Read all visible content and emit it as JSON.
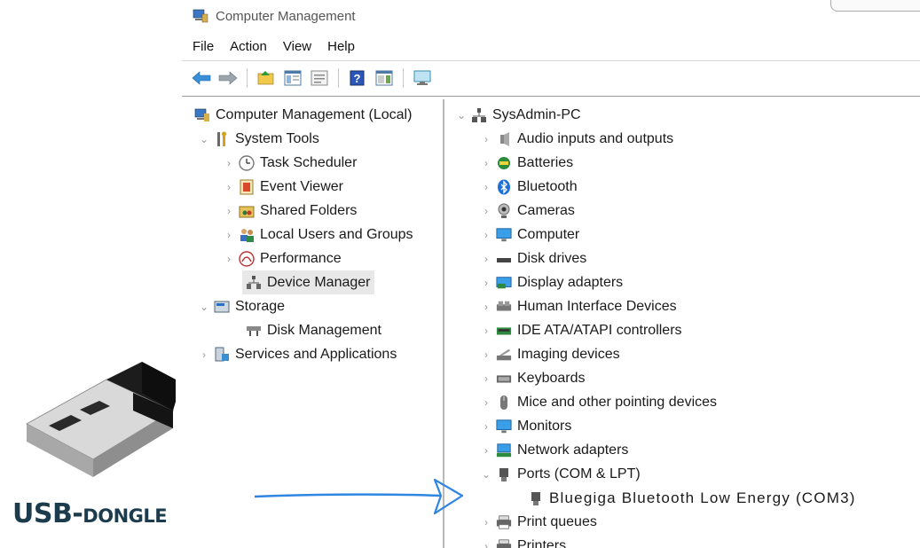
{
  "window": {
    "title": "Computer Management"
  },
  "menu": [
    "File",
    "Action",
    "View",
    "Help"
  ],
  "toolbar": [
    "back-icon",
    "forward-icon",
    "up-folder-icon",
    "show-tree-icon",
    "properties-icon",
    "help-icon",
    "action-pane-icon",
    "console-icon"
  ],
  "left_tree": [
    {
      "label": "Computer Management (Local)",
      "icon": "computer-mgmt-icon",
      "chevron": ""
    },
    {
      "label": "System Tools",
      "icon": "tools-icon",
      "chevron": "⌄"
    },
    {
      "label": "Task Scheduler",
      "icon": "clock-icon",
      "chevron": "›"
    },
    {
      "label": "Event Viewer",
      "icon": "event-viewer-icon",
      "chevron": "›"
    },
    {
      "label": "Shared Folders",
      "icon": "shared-folder-icon",
      "chevron": "›"
    },
    {
      "label": "Local Users and Groups",
      "icon": "users-icon",
      "chevron": "›"
    },
    {
      "label": "Performance",
      "icon": "performance-icon",
      "chevron": "›"
    },
    {
      "label": "Device Manager",
      "icon": "device-manager-icon",
      "chevron": ""
    },
    {
      "label": "Storage",
      "icon": "storage-icon",
      "chevron": "⌄"
    },
    {
      "label": "Disk Management",
      "icon": "disk-mgmt-icon",
      "chevron": ""
    },
    {
      "label": "Services and Applications",
      "icon": "services-icon",
      "chevron": "›"
    }
  ],
  "device_tree": {
    "root": "SysAdmin-PC",
    "items": [
      {
        "label": "Audio inputs and outputs",
        "icon": "speaker-icon"
      },
      {
        "label": "Batteries",
        "icon": "battery-icon"
      },
      {
        "label": "Bluetooth",
        "icon": "bluetooth-icon"
      },
      {
        "label": "Cameras",
        "icon": "camera-icon"
      },
      {
        "label": "Computer",
        "icon": "monitor-icon"
      },
      {
        "label": "Disk drives",
        "icon": "disk-drive-icon"
      },
      {
        "label": "Display adapters",
        "icon": "display-adapter-icon"
      },
      {
        "label": "Human Interface Devices",
        "icon": "hid-icon"
      },
      {
        "label": "IDE ATA/ATAPI controllers",
        "icon": "ide-icon"
      },
      {
        "label": "Imaging devices",
        "icon": "scanner-icon"
      },
      {
        "label": "Keyboards",
        "icon": "keyboard-icon"
      },
      {
        "label": "Mice and other pointing devices",
        "icon": "mouse-icon"
      },
      {
        "label": "Monitors",
        "icon": "monitor-icon"
      },
      {
        "label": "Network adapters",
        "icon": "network-icon"
      },
      {
        "label": "Ports (COM & LPT)",
        "icon": "port-icon"
      },
      {
        "label": "Bluegiga Bluetooth Low Energy (COM3)",
        "icon": "port-icon"
      },
      {
        "label": "Print queues",
        "icon": "printer-icon"
      },
      {
        "label": "Printers",
        "icon": "printer-icon"
      }
    ]
  },
  "annotation": {
    "label_big": "USB-",
    "label_small": "DONGLE",
    "arrow_color": "#2f86e0"
  },
  "colors": {
    "selection": "#e8e8e8",
    "label": "#1c3c4e"
  }
}
